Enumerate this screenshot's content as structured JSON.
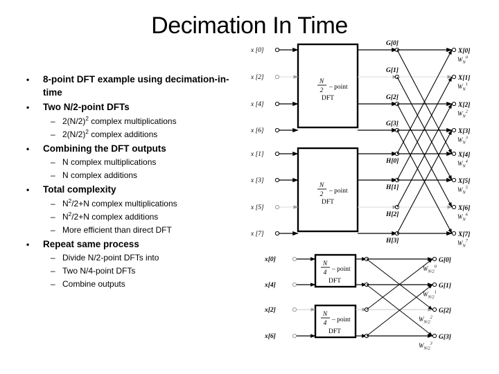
{
  "slide": {
    "title": "Decimation In Time"
  },
  "bullets": [
    {
      "level": 1,
      "mark": "•",
      "text": "8-point DFT example using decimation-in-time"
    },
    {
      "level": 1,
      "mark": "•",
      "text": "Two N/2-point DFTs"
    },
    {
      "level": 2,
      "mark": "–",
      "text": "2(N/2)",
      "sup": "2",
      "tail": " complex multiplications"
    },
    {
      "level": 2,
      "mark": "–",
      "text": "2(N/2)",
      "sup": "2",
      "tail": " complex additions"
    },
    {
      "level": 1,
      "mark": "•",
      "text": "Combining the DFT outputs"
    },
    {
      "level": 2,
      "mark": "–",
      "text": "N complex multiplications"
    },
    {
      "level": 2,
      "mark": "–",
      "text": "N complex additions"
    },
    {
      "level": 1,
      "mark": "•",
      "text": "Total complexity"
    },
    {
      "level": 2,
      "mark": "–",
      "text": "N",
      "sup": "2",
      "tail": "/2+N complex multiplications"
    },
    {
      "level": 2,
      "mark": "–",
      "text": "N",
      "sup": "2",
      "tail": "/2+N complex additions"
    },
    {
      "level": 2,
      "mark": "–",
      "text": "More efficient than direct DFT"
    },
    {
      "level": 1,
      "mark": "•",
      "text": "Repeat same process"
    },
    {
      "level": 2,
      "mark": "–",
      "text": "Divide N/2-point DFTs into"
    },
    {
      "level": 2,
      "mark": "–",
      "text": "Two N/4-point DFTs"
    },
    {
      "level": 2,
      "mark": "–",
      "text": "Combine outputs"
    }
  ],
  "diagram_top": {
    "block_label_numerator": "N",
    "block_label_denominator": "2",
    "block_label_point": "– point",
    "block_label_dft": "DFT",
    "inputs_upper": [
      "x [0]",
      "x [2]",
      "x [4]",
      "x [6]"
    ],
    "inputs_lower": [
      "x [1]",
      "x [3]",
      "x [5]",
      "x [7]"
    ],
    "mid_upper": [
      "G[0]",
      "G[1]",
      "G[2]",
      "G[3]"
    ],
    "mid_lower": [
      "H[0]",
      "H[1]",
      "H[2]",
      "H[3]"
    ],
    "outputs": [
      "X[0]",
      "X[1]",
      "X[2]",
      "X[3]",
      "X[4]",
      "X[5]",
      "X[6]",
      "X[7]"
    ],
    "twiddle_base": "W",
    "twiddle_sub": "N",
    "twiddle_exponents": [
      "0",
      "1",
      "2",
      "3",
      "4",
      "5",
      "6",
      "7"
    ]
  },
  "diagram_bottom": {
    "block_label_numerator": "N",
    "block_label_denominator": "4",
    "block_label_point": "– point",
    "block_label_dft": "DFT",
    "inputs_upper": [
      "x[0]",
      "x[4]"
    ],
    "inputs_lower": [
      "x[2]",
      "x[6]"
    ],
    "outputs": [
      "G[0]",
      "G[1]",
      "G[2]",
      "G[3]"
    ],
    "twiddle_base": "W",
    "twiddle_sub": "N/2",
    "twiddle_exponents": [
      "0",
      "1",
      "2",
      "3"
    ]
  },
  "colors": {
    "background": "#ffffff",
    "ink": "#000000",
    "faint_ink": "#9a9a9a"
  }
}
